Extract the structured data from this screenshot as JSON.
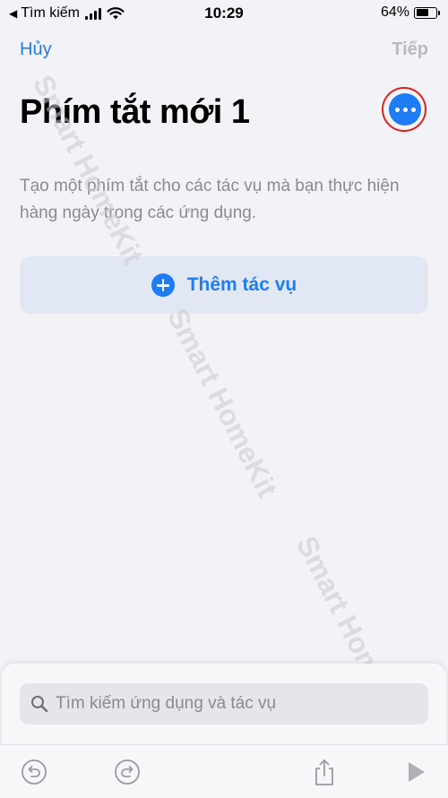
{
  "status_bar": {
    "back_app": "Tìm kiếm",
    "time": "10:29",
    "battery_text": "64%",
    "battery_level": 0.64
  },
  "nav": {
    "cancel_label": "Hủy",
    "next_label": "Tiếp"
  },
  "title": "Phím tắt mới 1",
  "description": "Tạo một phím tắt cho các tác vụ mà bạn thực hiện hàng ngày trong các ứng dụng.",
  "add_action": {
    "label": "Thêm tác vụ",
    "icon": "plus-circle-icon"
  },
  "search": {
    "placeholder": "Tìm kiếm ứng dụng và tác vụ"
  },
  "toolbar": {
    "icons": [
      "undo-icon",
      "redo-icon",
      "share-icon",
      "play-icon"
    ]
  },
  "watermark": "Smart HomeKit",
  "colors": {
    "accent": "#1e7cf5",
    "highlight_ring": "#e0201b",
    "background": "#f2f2f7"
  }
}
